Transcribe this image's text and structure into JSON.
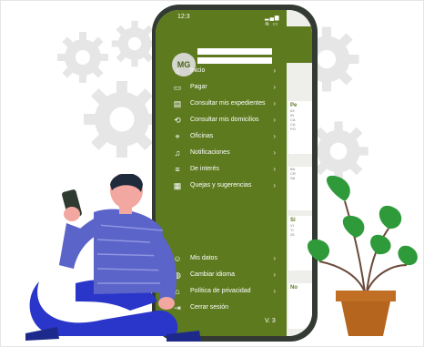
{
  "status": {
    "time": "12:3",
    "icons": "▂▄▆ ≋ ▭"
  },
  "user": {
    "initials": "MG",
    "name": "",
    "id": ""
  },
  "menu": {
    "items": [
      {
        "label": "Inicio",
        "icon": "home-icon",
        "glyph": "⌂"
      },
      {
        "label": "Pagar",
        "icon": "card-icon",
        "glyph": "▭"
      },
      {
        "label": "Consultar mis expedientes",
        "icon": "folder-icon",
        "glyph": "▤"
      },
      {
        "label": "Consultar mis domicilios",
        "icon": "refresh-icon",
        "glyph": "⟲"
      },
      {
        "label": "Oficinas",
        "icon": "location-icon",
        "glyph": "⌖"
      },
      {
        "label": "Notificaciones",
        "icon": "bell-icon",
        "glyph": "♫"
      },
      {
        "label": "De interés",
        "icon": "list-icon",
        "glyph": "≡"
      },
      {
        "label": "Quejas y sugerencias",
        "icon": "document-icon",
        "glyph": "▦"
      }
    ],
    "bottom_items": [
      {
        "label": "Mis datos",
        "icon": "user-icon",
        "glyph": "☺"
      },
      {
        "label": "Cambiar idioma",
        "icon": "globe-icon",
        "glyph": "◍"
      },
      {
        "label": "Política de privacidad",
        "icon": "lock-icon",
        "glyph": "⌂"
      },
      {
        "label": "Cerrar sesión",
        "icon": "logout-icon",
        "glyph": "⇥"
      }
    ],
    "chevron": "›",
    "version": "V. 3"
  },
  "right_panel": {
    "cards": [
      {
        "title": "Pe",
        "lines": [
          "03",
          "IN",
          "",
          "CA",
          "CA",
          "PO"
        ]
      },
      {
        "title": "",
        "lines": [
          "BA",
          "CR",
          "SA"
        ]
      },
      {
        "title": "Si",
        "lines": [
          "VI",
          "\"0",
          "25"
        ]
      },
      {
        "title": "No",
        "lines": []
      }
    ]
  },
  "colors": {
    "menu_bg": "#5d7a1f",
    "phone": "#333a33",
    "shirt": "#5b64c9",
    "pants": "#2a35c9",
    "plant_leaf": "#2f9a3a",
    "pot": "#b5651d"
  }
}
